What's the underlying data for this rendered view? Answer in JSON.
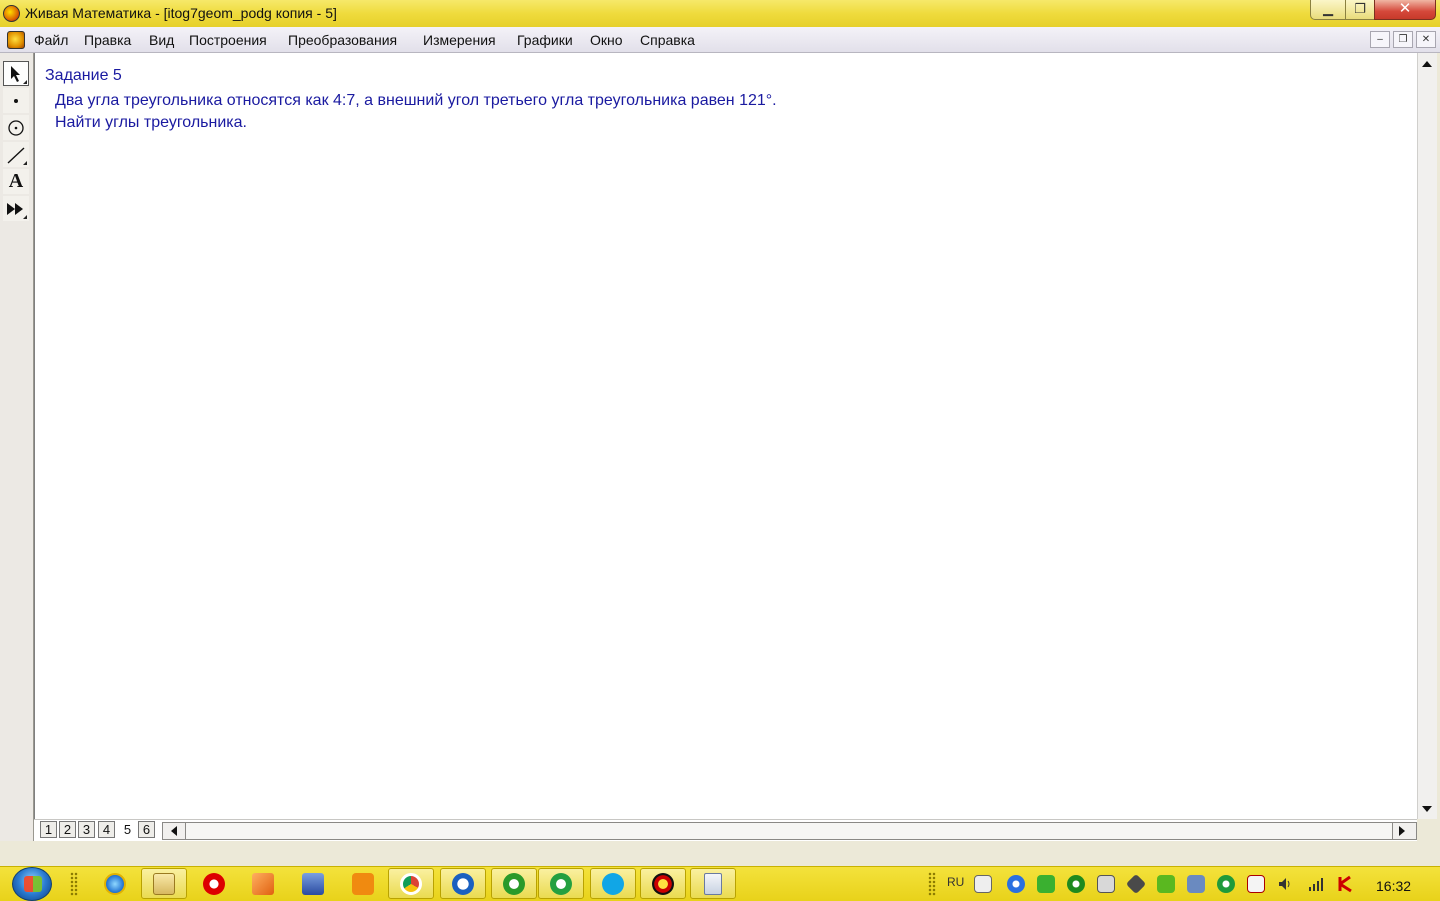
{
  "window": {
    "title": "Живая Математика - [itog7geom_podg копия - 5]"
  },
  "menu": {
    "items": [
      {
        "label": "Файл"
      },
      {
        "label": "Правка"
      },
      {
        "label": "Вид"
      },
      {
        "label": "Построения"
      },
      {
        "label": "Преобразования"
      },
      {
        "label": "Измерения"
      },
      {
        "label": "Графики"
      },
      {
        "label": "Окно"
      },
      {
        "label": "Справка"
      }
    ]
  },
  "tools": [
    {
      "name": "arrow-tool",
      "selected": true
    },
    {
      "name": "point-tool"
    },
    {
      "name": "compass-tool"
    },
    {
      "name": "straightedge-tool"
    },
    {
      "name": "text-tool",
      "glyph": "A"
    },
    {
      "name": "custom-tool"
    }
  ],
  "document": {
    "title": "Задание 5",
    "line1": "Два угла треугольника относятся как 4:7, а внешний угол третьего угла треугольника равен 121°.",
    "line2": "Найти углы треугольника."
  },
  "pages": {
    "tabs": [
      "1",
      "2",
      "3",
      "4",
      "5",
      "6"
    ],
    "active": "5"
  },
  "taskbar": {
    "language": "RU",
    "clock": "16:32"
  },
  "colors": {
    "title_bar": "#efdb3d",
    "taskbar": "#ecd62a",
    "document_text": "#1a1aa0"
  }
}
